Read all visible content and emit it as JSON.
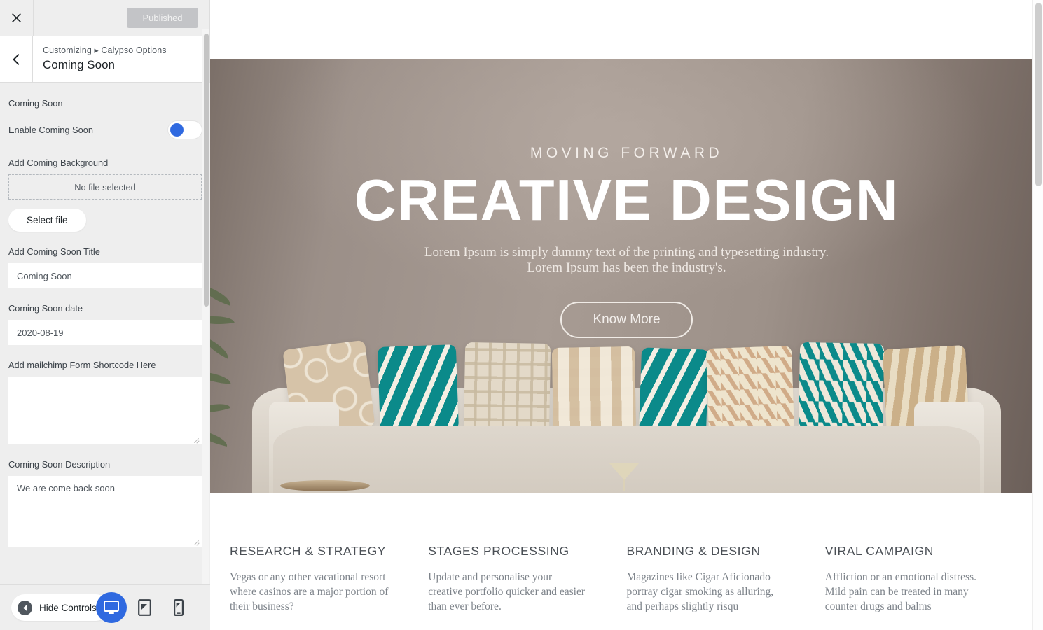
{
  "customizer": {
    "topbar": {
      "close_icon": "close-icon",
      "publish_label": "Published"
    },
    "header": {
      "breadcrumb": "Customizing ▸ Calypso Options",
      "panel_title": "Coming Soon",
      "back_icon": "chevron-left-icon"
    },
    "section_title": "Coming Soon",
    "controls": {
      "enable_label": "Enable Coming Soon",
      "enable_value": "on",
      "background_label": "Add Coming Background",
      "dropzone_text": "No file selected",
      "select_file_label": "Select file",
      "title_label": "Add Coming Soon Title",
      "title_value": "Coming Soon",
      "date_label": "Coming Soon date",
      "date_value": "2020-08-19",
      "mailchimp_label": "Add mailchimp Form Shortcode Here",
      "mailchimp_value": "",
      "description_label": "Coming Soon Description",
      "description_value": "We are come back soon"
    },
    "bottombar": {
      "hide_controls_label": "Hide Controls",
      "hide_controls_icon": "arrow-left-circle-icon",
      "devices": [
        {
          "name": "desktop",
          "icon": "desktop-icon",
          "active": true
        },
        {
          "name": "tablet",
          "icon": "tablet-icon",
          "active": false
        },
        {
          "name": "mobile",
          "icon": "mobile-icon",
          "active": false
        }
      ]
    },
    "colors": {
      "accent": "#2f69e0",
      "panel_bg": "#eeeeee",
      "publish_bg": "#c3c4c7"
    }
  },
  "preview": {
    "hero": {
      "kicker": "MOVING FORWARD",
      "title": "CREATIVE DESIGN",
      "subtitle_line1": "Lorem Ipsum is simply dummy text of the printing and typesetting industry.",
      "subtitle_line2": "Lorem Ipsum has been the industry's.",
      "cta_label": "Know More",
      "background_color": "#97897f",
      "accent_pillow_color": "#0b8a8a"
    },
    "features": [
      {
        "title": "RESEARCH & STRATEGY",
        "body": "Vegas or any other vacational resort where casinos are a major portion of their business?"
      },
      {
        "title": "STAGES PROCESSING",
        "body": "Update and personalise your creative portfolio quicker and easier than ever before."
      },
      {
        "title": "BRANDING & DESIGN",
        "body": "Magazines like Cigar Aficionado portray cigar smoking as alluring, and perhaps slightly risqu"
      },
      {
        "title": "VIRAL CAMPAIGN",
        "body": "Affliction or an emotional distress. Mild pain can be treated in many counter drugs and balms"
      }
    ]
  }
}
